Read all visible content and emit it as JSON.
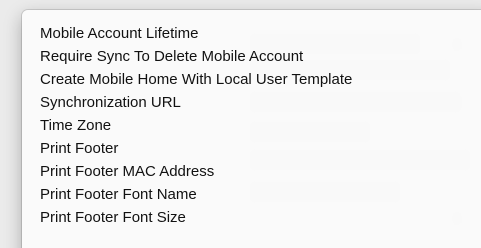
{
  "menu": {
    "items": [
      {
        "label": "Mobile Account Lifetime"
      },
      {
        "label": "Require Sync To Delete Mobile Account"
      },
      {
        "label": "Create Mobile Home With Local User Template"
      },
      {
        "label": "Synchronization URL"
      },
      {
        "label": "Time Zone"
      },
      {
        "label": "Print Footer"
      },
      {
        "label": "Print Footer MAC Address"
      },
      {
        "label": "Print Footer Font Name"
      },
      {
        "label": "Print Footer Font Size"
      }
    ]
  },
  "icons": {
    "background_row_chevron": "chevron-updown-icon"
  }
}
